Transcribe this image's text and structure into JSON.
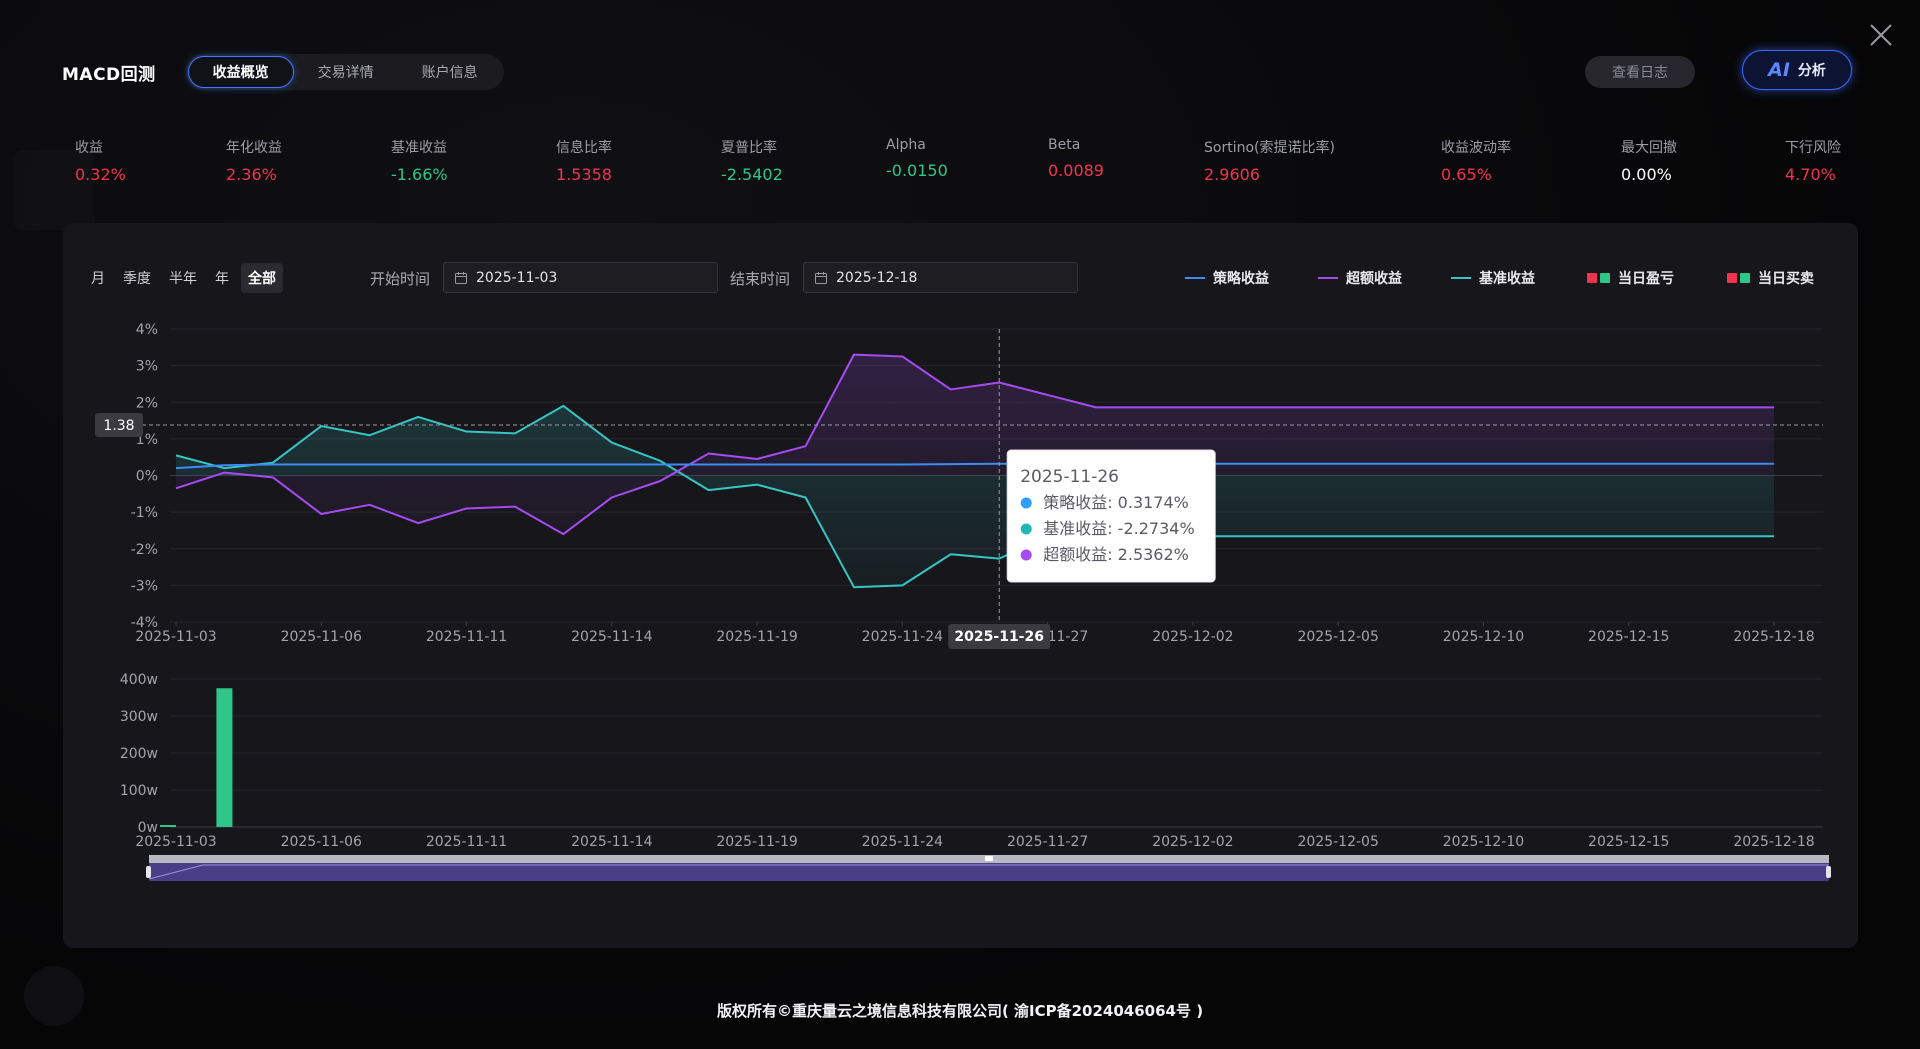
{
  "header": {
    "title": "MACD回测",
    "tabs": [
      {
        "label": "收益概览",
        "active": true
      },
      {
        "label": "交易详情",
        "active": false
      },
      {
        "label": "账户信息",
        "active": false
      }
    ],
    "log_button": "查看日志",
    "ai_button": {
      "glyph": "AI",
      "label": "分析"
    }
  },
  "metrics": [
    {
      "label": "收益",
      "value": "0.32%",
      "tone": "red"
    },
    {
      "label": "年化收益",
      "value": "2.36%",
      "tone": "red"
    },
    {
      "label": "基准收益",
      "value": "-1.66%",
      "tone": "green"
    },
    {
      "label": "信息比率",
      "value": "1.5358",
      "tone": "red"
    },
    {
      "label": "夏普比率",
      "value": "-2.5402",
      "tone": "green"
    },
    {
      "label": "Alpha",
      "value": "-0.0150",
      "tone": "green"
    },
    {
      "label": "Beta",
      "value": "0.0089",
      "tone": "red"
    },
    {
      "label": "Sortino(索提诺比率)",
      "value": "2.9606",
      "tone": "red"
    },
    {
      "label": "收益波动率",
      "value": "0.65%",
      "tone": "red"
    },
    {
      "label": "最大回撤",
      "value": "0.00%",
      "tone": "white"
    },
    {
      "label": "下行风险",
      "value": "4.70%",
      "tone": "red"
    }
  ],
  "filters": {
    "ranges": [
      {
        "label": "月",
        "active": false
      },
      {
        "label": "季度",
        "active": false
      },
      {
        "label": "半年",
        "active": false
      },
      {
        "label": "年",
        "active": false
      },
      {
        "label": "全部",
        "active": true
      }
    ],
    "start_label": "开始时间",
    "start_value": "2025-11-03",
    "end_label": "结束时间",
    "end_value": "2025-12-18"
  },
  "legend": [
    {
      "label": "策略收益",
      "kind": "line",
      "color": "#3d8bff"
    },
    {
      "label": "超额收益",
      "kind": "line",
      "color": "#a64bf4"
    },
    {
      "label": "基准收益",
      "kind": "line",
      "color": "#35c5c5"
    },
    {
      "label": "当日盈亏",
      "kind": "squares",
      "colors": [
        "#f0344f",
        "#2ec789"
      ]
    },
    {
      "label": "当日买卖",
      "kind": "squares",
      "colors": [
        "#f0344f",
        "#2ec789"
      ]
    }
  ],
  "colors": {
    "strategy": "#3d8bff",
    "excess": "#a64bf4",
    "benchmark": "#35c5c5",
    "bar_up": "#2ec789"
  },
  "tooltip": {
    "date": "2025-11-26",
    "rows": [
      {
        "label": "策略收益: 0.3174%",
        "color": "#2f9cff"
      },
      {
        "label": "基准收益: -2.2734%",
        "color": "#25b5b5"
      },
      {
        "label": "超额收益: 2.5362%",
        "color": "#a64bf4"
      }
    ]
  },
  "crosshair": {
    "y_value": "1.38",
    "x_value": "2025-11-26"
  },
  "chart_data": [
    {
      "type": "line",
      "ylim": [
        -4,
        4
      ],
      "y_ticks": [
        "4%",
        "3%",
        "2%",
        "1%",
        "0%",
        "-1%",
        "-2%",
        "-3%",
        "-4%"
      ],
      "x_tick_labels": [
        "2025-11-03",
        "2025-11-06",
        "2025-11-11",
        "2025-11-14",
        "2025-11-19",
        "2025-11-24",
        "2025-11-27",
        "2025-12-02",
        "2025-12-05",
        "2025-12-10",
        "2025-12-15",
        "2025-12-18"
      ],
      "x": [
        "2025-11-03",
        "2025-11-04",
        "2025-11-05",
        "2025-11-06",
        "2025-11-07",
        "2025-11-10",
        "2025-11-11",
        "2025-11-12",
        "2025-11-13",
        "2025-11-14",
        "2025-11-17",
        "2025-11-18",
        "2025-11-19",
        "2025-11-20",
        "2025-11-21",
        "2025-11-24",
        "2025-11-25",
        "2025-11-26",
        "2025-11-27",
        "2025-11-28",
        "2025-12-01",
        "2025-12-02",
        "2025-12-03",
        "2025-12-04",
        "2025-12-05",
        "2025-12-08",
        "2025-12-09",
        "2025-12-10",
        "2025-12-11",
        "2025-12-12",
        "2025-12-15",
        "2025-12-16",
        "2025-12-17",
        "2025-12-18"
      ],
      "series": [
        {
          "name": "策略收益",
          "values": [
            0.2,
            0.28,
            0.3,
            0.3,
            0.3,
            0.3,
            0.3,
            0.3,
            0.3,
            0.3,
            0.3,
            0.3,
            0.3,
            0.3,
            0.3,
            0.3,
            0.31,
            0.32,
            0.32,
            0.32,
            0.32,
            0.32,
            0.32,
            0.32,
            0.32,
            0.32,
            0.32,
            0.32,
            0.32,
            0.32,
            0.32,
            0.32,
            0.32,
            0.32
          ]
        },
        {
          "name": "基准收益",
          "values": [
            0.55,
            0.2,
            0.35,
            1.35,
            1.1,
            1.6,
            1.2,
            1.15,
            1.9,
            0.9,
            0.4,
            -0.4,
            -0.25,
            -0.6,
            -3.05,
            -3.0,
            -2.15,
            -2.27,
            -1.66,
            -1.66,
            -1.66,
            -1.66,
            -1.66,
            -1.66,
            -1.66,
            -1.66,
            -1.66,
            -1.66,
            -1.66,
            -1.66,
            -1.66,
            -1.66,
            -1.66,
            -1.66
          ]
        },
        {
          "name": "超额收益",
          "values": [
            -0.35,
            0.08,
            -0.05,
            -1.05,
            -0.8,
            -1.3,
            -0.9,
            -0.85,
            -1.6,
            -0.6,
            -0.15,
            0.6,
            0.45,
            0.8,
            3.3,
            3.25,
            2.35,
            2.54,
            2.2,
            1.86,
            1.86,
            1.86,
            1.86,
            1.86,
            1.86,
            1.86,
            1.86,
            1.86,
            1.86,
            1.86,
            1.86,
            1.86,
            1.86,
            1.86
          ]
        }
      ]
    },
    {
      "type": "bar",
      "ylim": [
        0,
        400
      ],
      "y_ticks": [
        "400w",
        "300w",
        "200w",
        "100w",
        "0w"
      ],
      "x_tick_labels": [
        "2025-11-03",
        "2025-11-06",
        "2025-11-11",
        "2025-11-14",
        "2025-11-19",
        "2025-11-24",
        "2025-11-27",
        "2025-12-02",
        "2025-12-05",
        "2025-12-10",
        "2025-12-15",
        "2025-12-18"
      ],
      "series": [
        {
          "name": "当日买卖",
          "values": [
            0,
            375,
            0,
            0,
            0,
            0,
            0,
            0,
            0,
            0,
            0,
            0,
            0,
            0,
            0,
            0,
            0,
            0,
            0,
            0,
            0,
            0,
            0,
            0,
            0,
            0,
            0,
            0,
            0,
            0,
            0,
            0,
            0,
            0
          ]
        }
      ]
    }
  ],
  "footer": "版权所有©重庆量云之境信息科技有限公司( 渝ICP备2024046064号 )"
}
